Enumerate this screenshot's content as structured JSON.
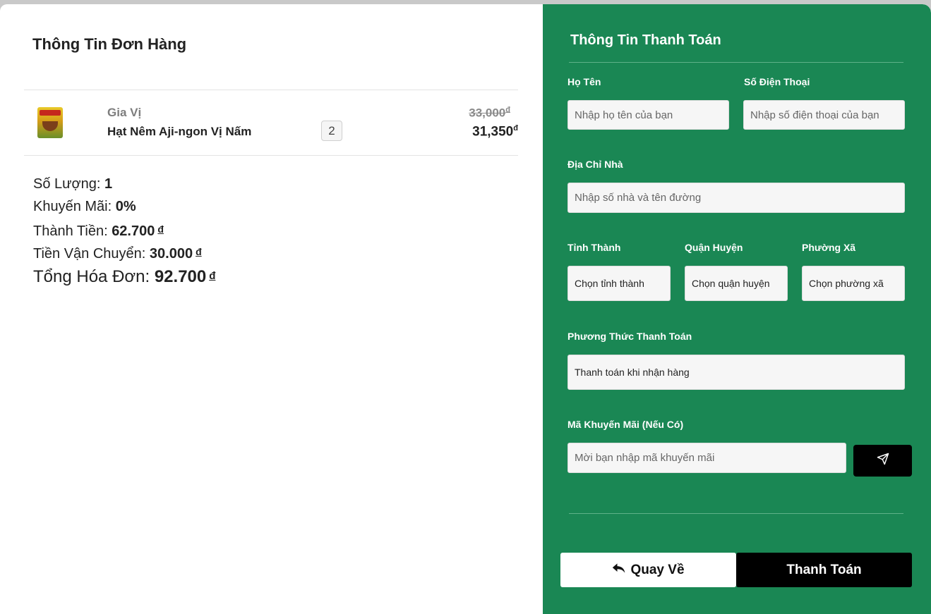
{
  "order": {
    "title": "Thông Tin Đơn Hàng",
    "item": {
      "image": "seasoning-package-icon",
      "category": "Gia Vị",
      "name": "Hạt Nêm Aji-ngon Vị Nấm",
      "quantity": "2",
      "price_old": "33,000",
      "price_new": "31,350",
      "currency": "đ"
    },
    "summary": {
      "qty_label": "Số Lượng: ",
      "qty_value": "1",
      "promo_label": "Khuyến Mãi: ",
      "promo_value": "0%",
      "subtotal_label": "Thành Tiền: ",
      "subtotal_value": "62.700",
      "shipping_label": "Tiền Vận Chuyển: ",
      "shipping_value": "30.000",
      "total_label": "Tổng Hóa Đơn: ",
      "total_value": "92.700",
      "currency": "đ"
    }
  },
  "payment": {
    "title": "Thông Tin Thanh Toán",
    "name_label": "Họ Tên",
    "name_placeholder": "Nhập họ tên của bạn",
    "phone_label": "Số Điện Thoại",
    "phone_placeholder": "Nhập số điện thoại của bạn",
    "address_label": "Địa Chỉ Nhà",
    "address_placeholder": "Nhập số nhà và tên đường",
    "province_label": "Tỉnh Thành",
    "province_value": "Chọn tỉnh thành",
    "district_label": "Quận Huyện",
    "district_value": "Chọn quận huyện",
    "ward_label": "Phường Xã",
    "ward_value": "Chọn phường xã",
    "method_label": "Phương Thức Thanh Toán",
    "method_value": "Thanh toán khi nhận hàng",
    "promo_label": "Mã Khuyến Mãi (Nếu Có)",
    "promo_placeholder": "Mời bạn nhập mã khuyến mãi",
    "back_label": "Quay Về",
    "pay_label": "Thanh Toán"
  },
  "colors": {
    "panel_green": "#1a8754",
    "button_black": "#000000"
  }
}
